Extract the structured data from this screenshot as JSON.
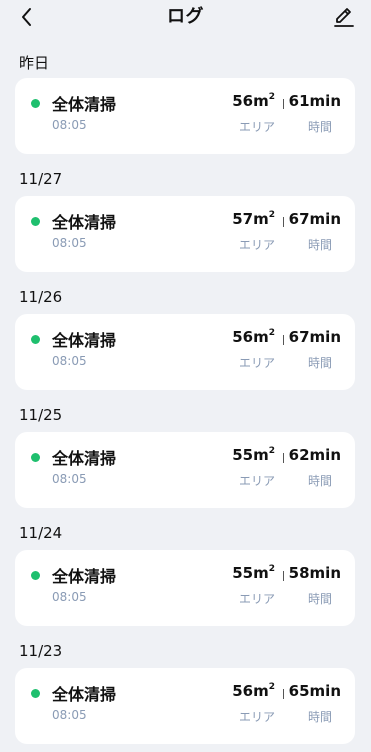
{
  "header": {
    "title": "ログ",
    "back_icon": "chevron-left-icon",
    "edit_icon": "edit-pen-icon"
  },
  "logs": [
    {
      "date": "昨日",
      "mode": "全体清掃",
      "time": "08:05",
      "area": "56m",
      "area_sup": "2",
      "duration": "61min",
      "area_label": "エリア",
      "duration_label": "時間"
    },
    {
      "date": "11/27",
      "mode": "全体清掃",
      "time": "08:05",
      "area": "57m",
      "area_sup": "2",
      "duration": "67min",
      "area_label": "エリア",
      "duration_label": "時間"
    },
    {
      "date": "11/26",
      "mode": "全体清掃",
      "time": "08:05",
      "area": "56m",
      "area_sup": "2",
      "duration": "67min",
      "area_label": "エリア",
      "duration_label": "時間"
    },
    {
      "date": "11/25",
      "mode": "全体清掃",
      "time": "08:05",
      "area": "55m",
      "area_sup": "2",
      "duration": "62min",
      "area_label": "エリア",
      "duration_label": "時間"
    },
    {
      "date": "11/24",
      "mode": "全体清掃",
      "time": "08:05",
      "area": "55m",
      "area_sup": "2",
      "duration": "58min",
      "area_label": "エリア",
      "duration_label": "時間"
    },
    {
      "date": "11/23",
      "mode": "全体清掃",
      "time": "08:05",
      "area": "56m",
      "area_sup": "2",
      "duration": "65min",
      "area_label": "エリア",
      "duration_label": "時間"
    }
  ],
  "colors": {
    "background": "#eff1f5",
    "card": "#ffffff",
    "status_dot": "#1fbf6e",
    "muted_text": "#8a9bb5"
  }
}
